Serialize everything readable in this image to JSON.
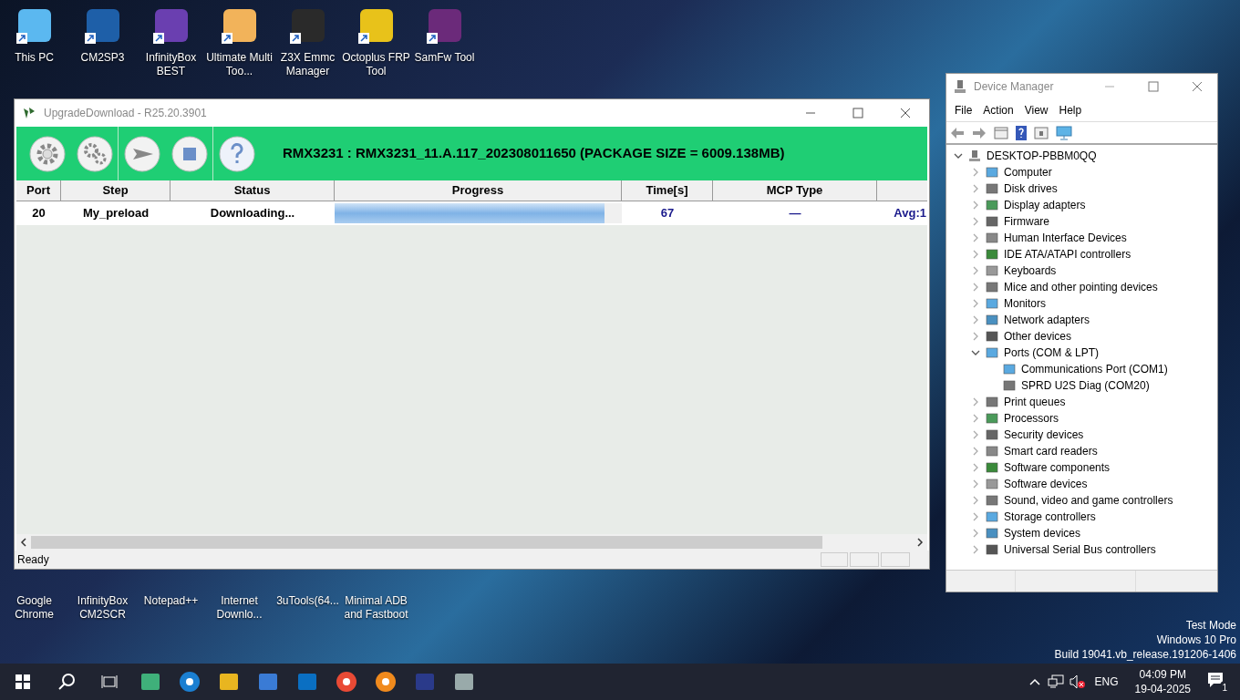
{
  "desktop_icons_top": [
    {
      "label": "This PC"
    },
    {
      "label": "CM2SP3"
    },
    {
      "label": "InfinityBox BEST"
    },
    {
      "label": "Ultimate Multi Too..."
    },
    {
      "label": "Z3X Emmc Manager"
    },
    {
      "label": "Octoplus FRP Tool"
    },
    {
      "label": "SamFw Tool"
    }
  ],
  "desktop_icons_bottom": [
    {
      "label": "Google Chrome"
    },
    {
      "label": "InfinityBox CM2SCR"
    },
    {
      "label": "Notepad++"
    },
    {
      "label": "Internet Downlo..."
    },
    {
      "label": "3uTools(64..."
    },
    {
      "label": "Minimal ADB and Fastboot"
    }
  ],
  "upgrade_window": {
    "title": "UpgradeDownload - R25.20.3901",
    "package_info": "RMX3231 : RMX3231_11.A.117_202308011650 (PACKAGE SIZE = 6009.138MB)",
    "columns": [
      "Port",
      "Step",
      "Status",
      "Progress",
      "Time[s]",
      "MCP Type"
    ],
    "rows": [
      {
        "port": "20",
        "step": "My_preload",
        "status": "Downloading...",
        "progress": {
          "level": 0.94
        },
        "time": "67",
        "mcp_type": "—",
        "column_7": "Avg:1"
      }
    ],
    "status_bar": "Ready"
  },
  "device_manager": {
    "title": "Device Manager",
    "menu": [
      "File",
      "Action",
      "View",
      "Help"
    ],
    "tree": {
      "label": "DESKTOP-PBBM0QQ",
      "expanded": true,
      "children": [
        {
          "label": "Computer",
          "expanded": false
        },
        {
          "label": "Disk drives",
          "expanded": false
        },
        {
          "label": "Display adapters",
          "expanded": false
        },
        {
          "label": "Firmware",
          "expanded": false
        },
        {
          "label": "Human Interface Devices",
          "expanded": false
        },
        {
          "label": "IDE ATA/ATAPI controllers",
          "expanded": false
        },
        {
          "label": "Keyboards",
          "expanded": false
        },
        {
          "label": "Mice and other pointing devices",
          "expanded": false
        },
        {
          "label": "Monitors",
          "expanded": false
        },
        {
          "label": "Network adapters",
          "expanded": false
        },
        {
          "label": "Other devices",
          "expanded": false
        },
        {
          "label": "Ports (COM & LPT)",
          "expanded": true,
          "children": [
            {
              "label": "Communications Port (COM1)"
            },
            {
              "label": "SPRD U2S Diag (COM20)"
            }
          ]
        },
        {
          "label": "Print queues",
          "expanded": false
        },
        {
          "label": "Processors",
          "expanded": false
        },
        {
          "label": "Security devices",
          "expanded": false
        },
        {
          "label": "Smart card readers",
          "expanded": false
        },
        {
          "label": "Software components",
          "expanded": false
        },
        {
          "label": "Software devices",
          "expanded": false
        },
        {
          "label": "Sound, video and game controllers",
          "expanded": false
        },
        {
          "label": "Storage controllers",
          "expanded": false
        },
        {
          "label": "System devices",
          "expanded": false
        },
        {
          "label": "Universal Serial Bus controllers",
          "expanded": false
        }
      ]
    }
  },
  "system_notice": [
    "Test Mode",
    "Windows 10 Pro",
    "Build 19041.vb_release.191206-1406"
  ],
  "taskbar": {
    "language": "ENG",
    "time": "04:09 PM",
    "date": "19-04-2025",
    "notification_count": "1"
  }
}
